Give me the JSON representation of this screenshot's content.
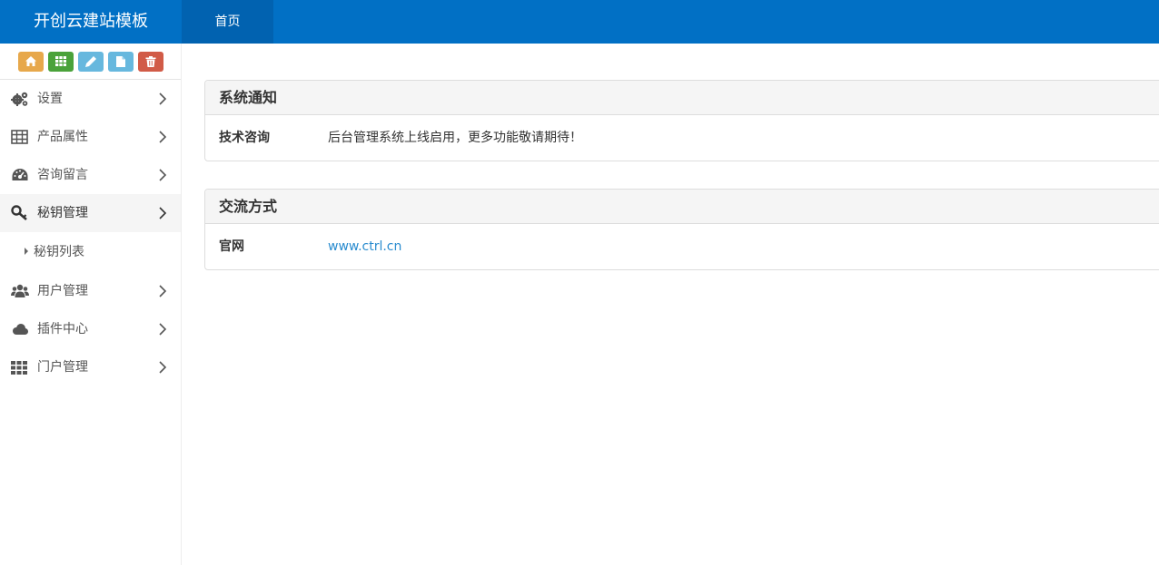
{
  "app": {
    "title": "开创云建站模板"
  },
  "topnav": {
    "items": [
      {
        "label": "首页"
      }
    ]
  },
  "shortcuts": [
    {
      "icon": "home-icon",
      "color": "#e7a84b"
    },
    {
      "icon": "grid-icon",
      "color": "#4aa23a"
    },
    {
      "icon": "pencil-icon",
      "color": "#67b8de"
    },
    {
      "icon": "file-icon",
      "color": "#67b8de"
    },
    {
      "icon": "trash-icon",
      "color": "#d15b47"
    }
  ],
  "sidebar": {
    "items": [
      {
        "label": "设置",
        "icon": "gears-icon"
      },
      {
        "label": "产品属性",
        "icon": "table-icon"
      },
      {
        "label": "咨询留言",
        "icon": "dashboard-icon"
      },
      {
        "label": "秘钥管理",
        "icon": "key-icon",
        "expanded": true,
        "children": [
          {
            "label": "秘钥列表"
          }
        ]
      },
      {
        "label": "用户管理",
        "icon": "users-icon"
      },
      {
        "label": "插件中心",
        "icon": "cloud-icon"
      },
      {
        "label": "门户管理",
        "icon": "th-icon"
      }
    ]
  },
  "panels": [
    {
      "title": "系统通知",
      "rows": [
        {
          "key": "技术咨询",
          "value": "后台管理系统上线启用，更多功能敬请期待！"
        }
      ]
    },
    {
      "title": "交流方式",
      "rows": [
        {
          "key": "官网",
          "value": "www.ctrl.cn"
        }
      ]
    }
  ],
  "colors": {
    "topbar": "#0170c5",
    "topnav_active": "#0162b0",
    "link": "#2a8ccf"
  }
}
